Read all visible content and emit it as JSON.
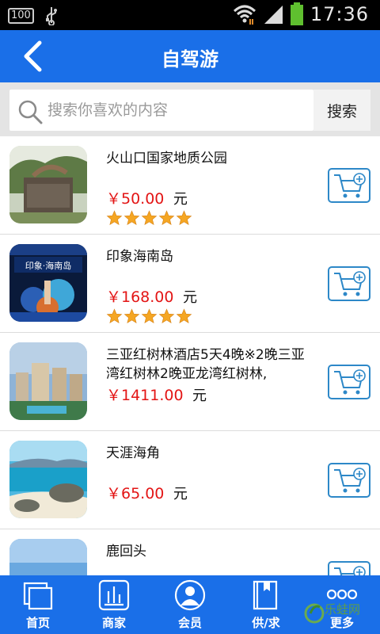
{
  "status_bar": {
    "battery_badge": "100",
    "time": "17:36"
  },
  "header": {
    "title": "自驾游"
  },
  "search": {
    "placeholder": "搜索你喜欢的内容",
    "button_label": "搜索"
  },
  "items": [
    {
      "name": "火山口国家地质公园",
      "price": "￥50.00",
      "unit": "元",
      "rating": 5
    },
    {
      "name": "印象海南岛",
      "price": "￥168.00",
      "unit": "元",
      "rating": 5,
      "thumb_text": "印象·海南岛"
    },
    {
      "name": "三亚红树林酒店5天4晚※2晚三亚湾红树林2晚亚龙湾红树林,",
      "price": "￥1411.00",
      "unit": "元"
    },
    {
      "name": "天涯海角",
      "price": "￥65.00",
      "unit": "元"
    },
    {
      "name": "鹿回头"
    }
  ],
  "bottom_nav": [
    {
      "label": "首页",
      "icon": "home-pages-icon"
    },
    {
      "label": "商家",
      "icon": "merchant-chart-icon"
    },
    {
      "label": "会员",
      "icon": "member-person-icon"
    },
    {
      "label": "供/求",
      "icon": "supply-book-icon"
    },
    {
      "label": "更多",
      "icon": "more-dots-icon"
    }
  ],
  "watermark": {
    "text": "乐蛙网"
  },
  "colors": {
    "primary": "#1a6fe8",
    "price": "#e31515",
    "star": "#f5a623",
    "cart_border": "#2d88c8"
  }
}
